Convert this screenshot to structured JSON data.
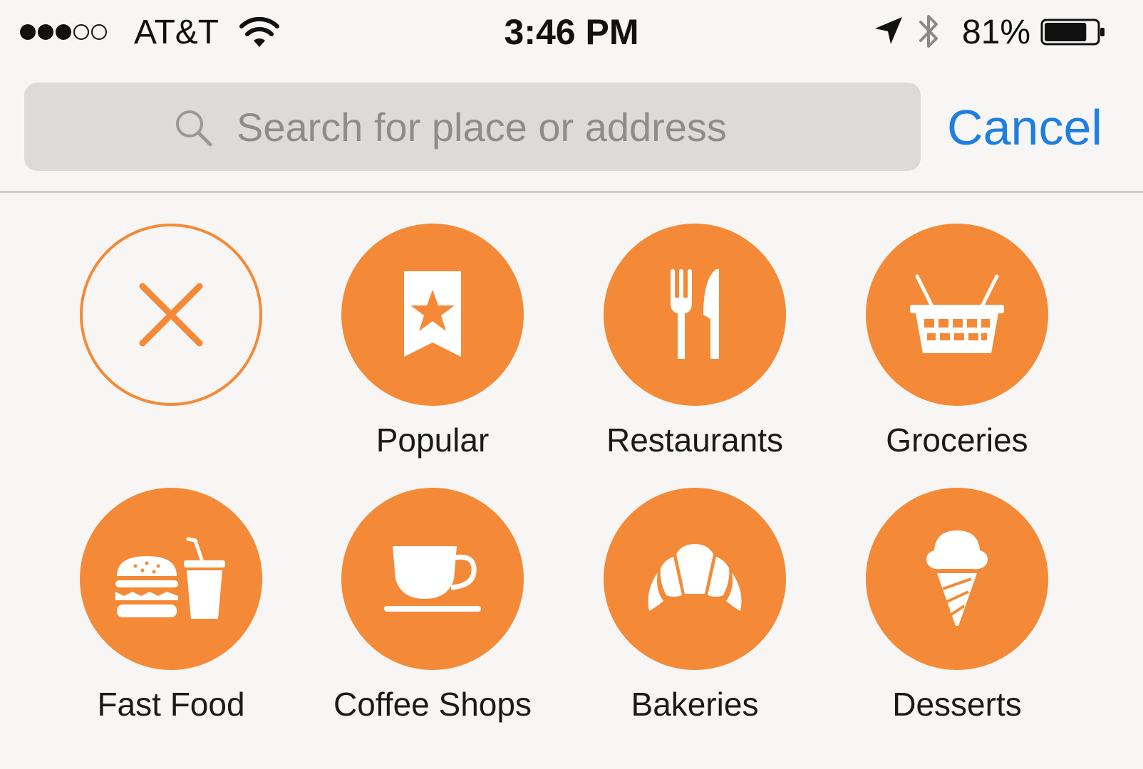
{
  "status_bar": {
    "signal_bars_filled": 3,
    "signal_bars_total": 5,
    "carrier": "AT&T",
    "time": "3:46 PM",
    "battery_percent": "81%",
    "battery_level": 0.81,
    "icons": [
      "wifi-icon",
      "location-arrow-icon",
      "bluetooth-icon",
      "battery-icon"
    ]
  },
  "search": {
    "placeholder": "Search for place or address",
    "value": "",
    "cancel_label": "Cancel"
  },
  "categories": [
    {
      "label": "",
      "icon": "close-icon",
      "style": "outline"
    },
    {
      "label": "Popular",
      "icon": "bookmark-star-icon"
    },
    {
      "label": "Restaurants",
      "icon": "fork-knife-icon"
    },
    {
      "label": "Groceries",
      "icon": "shopping-basket-icon"
    },
    {
      "label": "Fast Food",
      "icon": "burger-drink-icon"
    },
    {
      "label": "Coffee Shops",
      "icon": "coffee-cup-icon"
    },
    {
      "label": "Bakeries",
      "icon": "croissant-icon"
    },
    {
      "label": "Desserts",
      "icon": "ice-cream-icon"
    }
  ],
  "colors": {
    "accent": "#f48a37",
    "link": "#1f7fe0",
    "background": "#f7f6f4",
    "search_field": "#dcdbd9"
  }
}
